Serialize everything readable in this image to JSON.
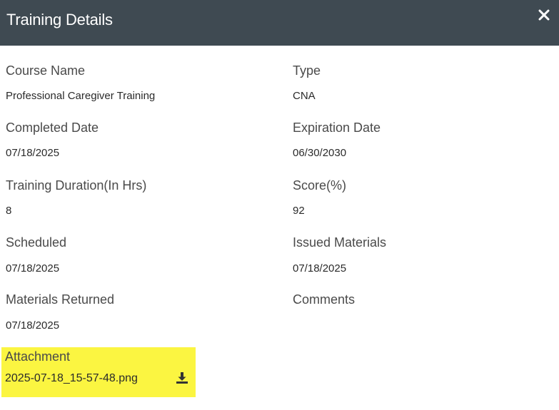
{
  "header": {
    "title": "Training Details"
  },
  "fields": {
    "course_name": {
      "label": "Course Name",
      "value": "Professional Caregiver Training"
    },
    "type": {
      "label": "Type",
      "value": "CNA"
    },
    "completed_date": {
      "label": "Completed Date",
      "value": "07/18/2025"
    },
    "expiration_date": {
      "label": "Expiration Date",
      "value": "06/30/2030"
    },
    "training_duration": {
      "label": "Training Duration(In Hrs)",
      "value": "8"
    },
    "score": {
      "label": "Score(%)",
      "value": "92"
    },
    "scheduled": {
      "label": "Scheduled",
      "value": "07/18/2025"
    },
    "issued_materials": {
      "label": "Issued Materials",
      "value": "07/18/2025"
    },
    "materials_returned": {
      "label": "Materials Returned",
      "value": "07/18/2025"
    },
    "comments": {
      "label": "Comments",
      "value": ""
    }
  },
  "attachment": {
    "label": "Attachment",
    "filename": "2025-07-18_15-57-48.png",
    "icon": "download-icon"
  },
  "colors": {
    "header_bg": "#3f4a52",
    "highlight": "#fbf541"
  }
}
